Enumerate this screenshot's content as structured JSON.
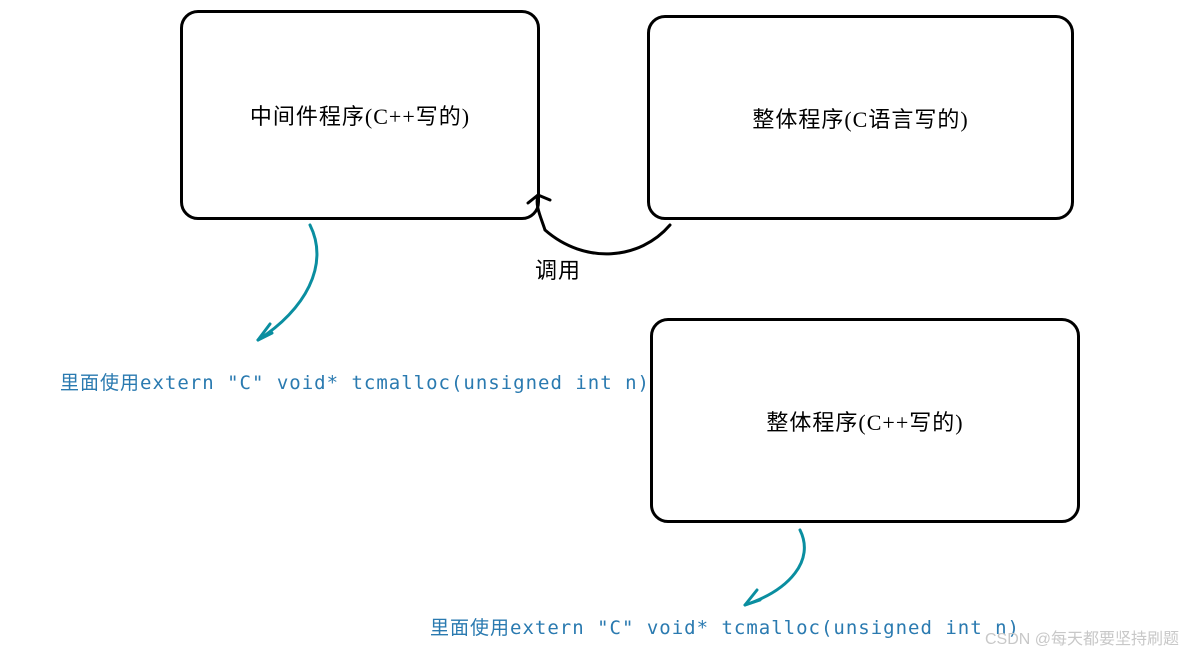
{
  "boxes": {
    "middleware": {
      "label": "中间件程序(C++写的)"
    },
    "overall_c": {
      "label": "整体程序(C语言写的)"
    },
    "overall_cpp": {
      "label": "整体程序(C++写的)"
    }
  },
  "labels": {
    "call": "调用",
    "extern_c_1": "里面使用extern \"C\" void* tcmalloc(unsigned int n)",
    "extern_c_2": "里面使用extern \"C\" void* tcmalloc(unsigned int n)"
  },
  "watermark": "CSDN @每天都要坚持刷题",
  "colors": {
    "blue_text": "#2a7ab0",
    "arrow_teal": "#0a8ea0",
    "arrow_black": "#000000"
  }
}
